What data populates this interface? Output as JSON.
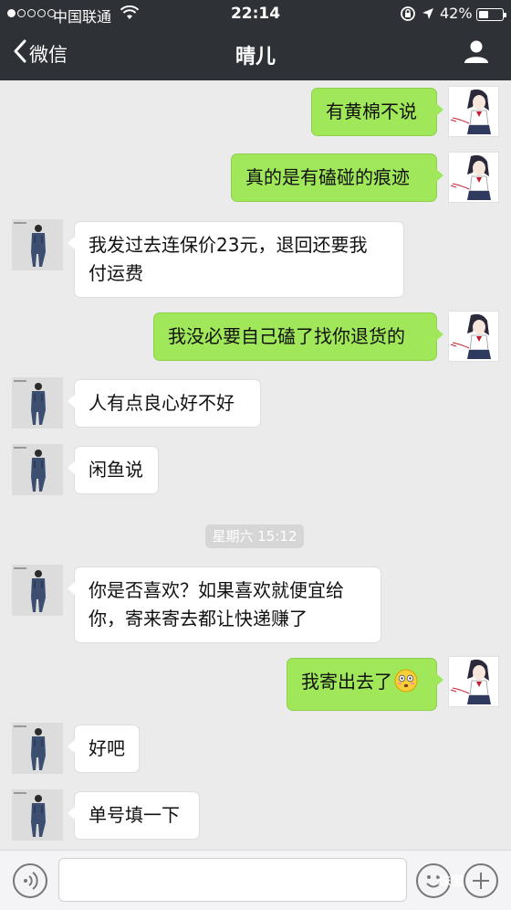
{
  "status_bar": {
    "carrier": "中国联通",
    "time": "22:14",
    "battery": "42%",
    "battery_level": 0.42
  },
  "header": {
    "back_label": "微信",
    "title": "晴儿"
  },
  "messages": [
    {
      "side": "me",
      "text": "有黄棉不说"
    },
    {
      "side": "me",
      "text": "真的是有磕碰的痕迹"
    },
    {
      "side": "other",
      "text": "我发过去连保价23元，退回还要我\n付运费"
    },
    {
      "side": "me",
      "text": "我没必要自己磕了找你退货的"
    },
    {
      "side": "other",
      "text": "人有点良心好不好"
    },
    {
      "side": "other",
      "text": "闲鱼说"
    },
    {
      "side": "other",
      "text": "你是否喜欢？如果喜欢就便宜给\n你，寄来寄去都让快递赚了"
    },
    {
      "side": "me",
      "text": "我寄出去了",
      "emoji": "flushed-face"
    },
    {
      "side": "other",
      "text": "好吧"
    },
    {
      "side": "other",
      "text": "单号填一下"
    }
  ],
  "timestamp": "星期六 15:12",
  "input": {
    "value": ""
  },
  "watermark": "珠宝"
}
